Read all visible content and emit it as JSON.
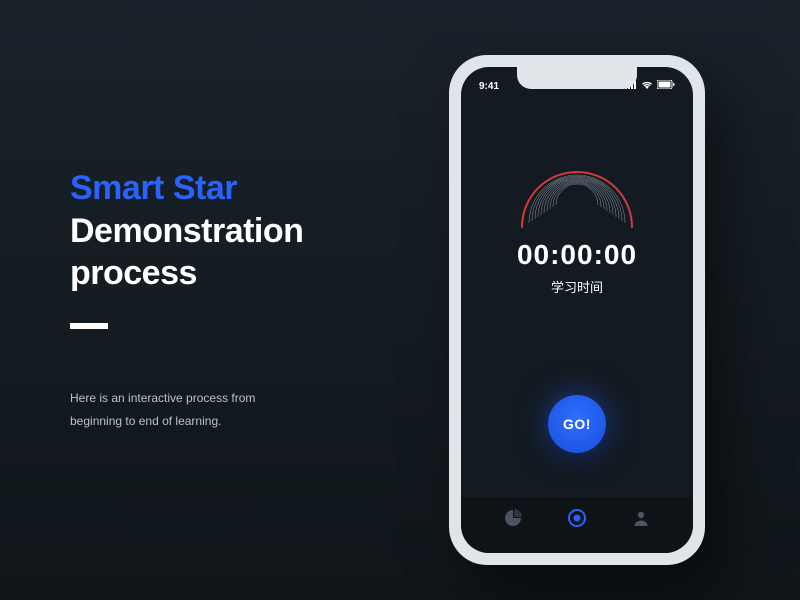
{
  "left_panel": {
    "title_line_1": "Smart Star",
    "title_line_2": "Demonstration",
    "title_line_3": "process",
    "subtitle": "Here is an interactive process from beginning to end of learning."
  },
  "phone": {
    "status_bar": {
      "time": "9:41"
    },
    "timer": {
      "display": "00:00:00",
      "label": "学习时间"
    },
    "go_button": {
      "label": "GO!"
    }
  },
  "colors": {
    "accent": "#2962ff",
    "gauge_outer": "#d13b3b"
  }
}
